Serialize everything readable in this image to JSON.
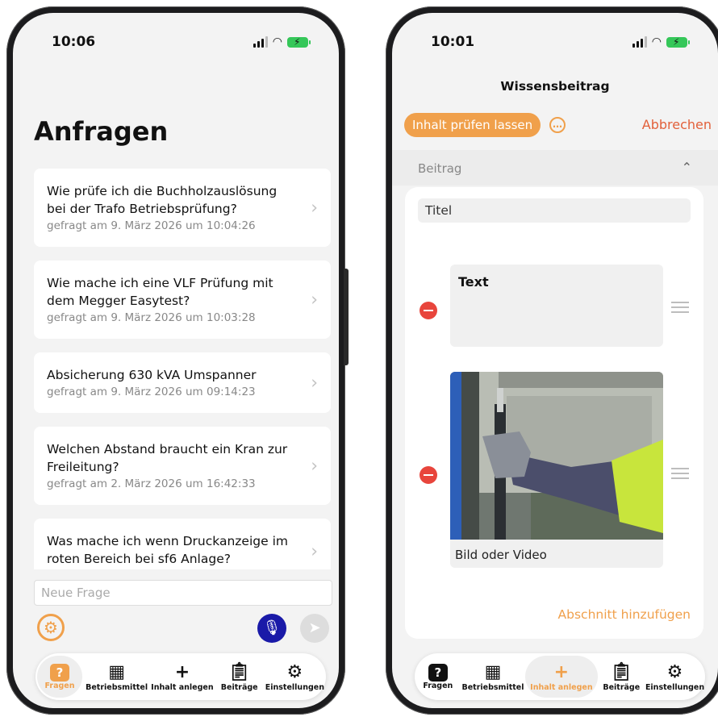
{
  "left_screen": {
    "status_time": "10:06",
    "title": "Anfragen",
    "questions": [
      {
        "text": "Wie prüfe ich die Buchholzauslösung bei der Trafo Betriebsprüfung?",
        "date": "gefragt am 9. März 2026 um 10:04:26"
      },
      {
        "text": "Wie mache ich eine VLF Prüfung mit dem Megger Easytest?",
        "date": "gefragt am 9. März 2026 um 10:03:28"
      },
      {
        "text": "Absicherung 630 kVA Umspanner",
        "date": "gefragt am 9. März 2026 um 09:14:23"
      },
      {
        "text": "Welchen Abstand braucht ein Kran zur Freileitung?",
        "date": "gefragt am 2. März 2026 um 16:42:33"
      },
      {
        "text": "Was mache ich wenn Druckanzeige im roten Bereich bei sf6 Anlage?",
        "date": ""
      }
    ],
    "new_question_placeholder": "Neue Frage",
    "tabs": [
      {
        "label": "Fragen",
        "icon": "question-icon",
        "active": true
      },
      {
        "label": "Betriebsmittel",
        "icon": "building-icon",
        "active": false
      },
      {
        "label": "Inhalt anlegen",
        "icon": "plus-icon",
        "active": false
      },
      {
        "label": "Beiträge",
        "icon": "clipboard-icon",
        "active": false
      },
      {
        "label": "Einstellungen",
        "icon": "gear-icon",
        "active": false
      }
    ]
  },
  "right_screen": {
    "status_time": "10:01",
    "nav_title": "Wissensbeitrag",
    "review_button": "Inhalt prüfen lassen",
    "cancel": "Abbrechen",
    "section_label": "Beitrag",
    "title_placeholder": "Titel",
    "text_placeholder": "Text",
    "image_caption": "Bild oder Video",
    "add_section": "Abschnitt hinzufügen",
    "tabs": [
      {
        "label": "Fragen",
        "icon": "question-icon",
        "active": false
      },
      {
        "label": "Betriebsmittel",
        "icon": "building-icon",
        "active": false
      },
      {
        "label": "Inhalt anlegen",
        "icon": "plus-icon",
        "active": true
      },
      {
        "label": "Beiträge",
        "icon": "clipboard-icon",
        "active": false
      },
      {
        "label": "Einstellungen",
        "icon": "gear-icon",
        "active": false
      }
    ]
  },
  "colors": {
    "accent": "#f0a04b",
    "danger": "#e8453c",
    "mic": "#1a1aa8",
    "cancel": "#e2603a"
  }
}
